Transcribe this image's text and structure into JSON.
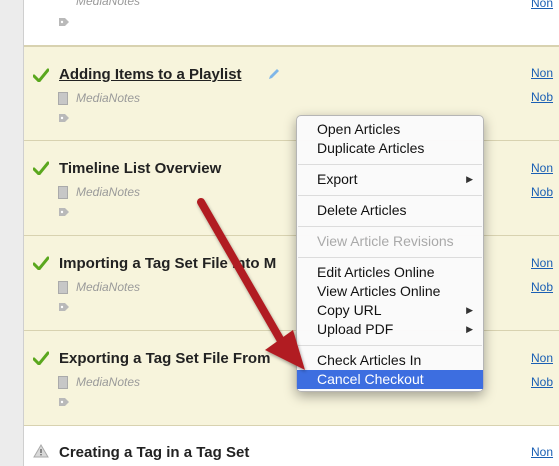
{
  "rows": [
    {
      "title": "",
      "project": "MediaNotes",
      "link1": "Non",
      "link2": ""
    },
    {
      "title": "Adding Items to a Playlist",
      "project": "MediaNotes",
      "link1": "Non",
      "link2": "Nob"
    },
    {
      "title": "Timeline List Overview",
      "project": "MediaNotes",
      "link1": "Non",
      "link2": "Nob"
    },
    {
      "title": "Importing a Tag Set File into M",
      "project": "MediaNotes",
      "link1": "Non",
      "link2": "Nob"
    },
    {
      "title": "Exporting a Tag Set File From",
      "project": "MediaNotes",
      "link1": "Non",
      "link2": "Nob"
    },
    {
      "title": "Creating a Tag in a Tag Set",
      "project": "",
      "link1": "Non",
      "link2": ""
    }
  ],
  "context_menu": {
    "items": [
      {
        "label": "Open Articles",
        "submenu": false,
        "disabled": false,
        "active": false
      },
      {
        "label": "Duplicate Articles",
        "submenu": false,
        "disabled": false,
        "active": false
      },
      {
        "label": "Export",
        "submenu": true,
        "disabled": false,
        "active": false
      },
      {
        "label": "Delete Articles",
        "submenu": false,
        "disabled": false,
        "active": false
      },
      {
        "label": "View Article Revisions",
        "submenu": false,
        "disabled": true,
        "active": false
      },
      {
        "label": "Edit Articles Online",
        "submenu": false,
        "disabled": false,
        "active": false
      },
      {
        "label": "View Articles Online",
        "submenu": false,
        "disabled": false,
        "active": false
      },
      {
        "label": "Copy URL",
        "submenu": true,
        "disabled": false,
        "active": false
      },
      {
        "label": "Upload PDF",
        "submenu": true,
        "disabled": false,
        "active": false
      },
      {
        "label": "Check Articles In",
        "submenu": false,
        "disabled": false,
        "active": false
      },
      {
        "label": "Cancel Checkout",
        "submenu": false,
        "disabled": false,
        "active": true
      }
    ],
    "submenu_glyph": "▶"
  },
  "colors": {
    "selected_row": "#f7f4dc",
    "menu_highlight": "#3d6ee0",
    "annotation_arrow": "#b11e22",
    "check_green": "#5aa71e",
    "link_blue": "#1a5fb4"
  },
  "icons": {
    "check": "checkmark-icon",
    "warning": "warning-icon",
    "document": "document-icon",
    "tag": "tag-icon",
    "pencil": "pencil-icon"
  }
}
